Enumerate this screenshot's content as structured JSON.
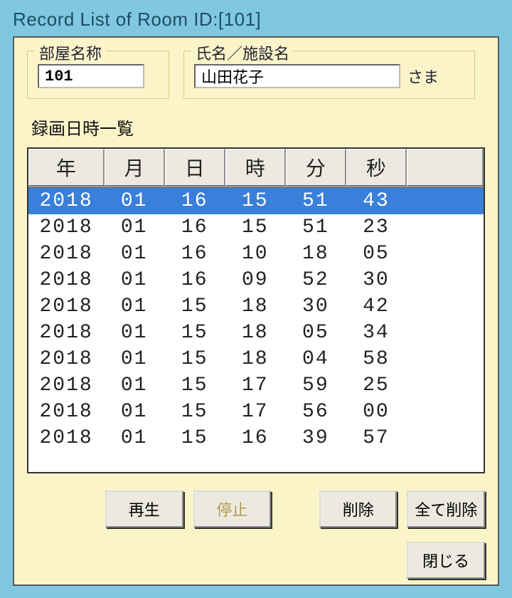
{
  "window": {
    "title": "Record List of Room ID:[101]"
  },
  "fields": {
    "room_label": "部屋名称",
    "room_value": "101",
    "name_label": "氏名／施設名",
    "name_value": "山田花子",
    "honorific": "さま"
  },
  "list_label": "録画日時一覧",
  "columns": {
    "year": "年",
    "month": "月",
    "day": "日",
    "hour": "時",
    "minute": "分",
    "second": "秒"
  },
  "rows": [
    {
      "y": "2018",
      "m": "01",
      "d": "16",
      "h": "15",
      "mi": "51",
      "s": "43",
      "selected": true
    },
    {
      "y": "2018",
      "m": "01",
      "d": "16",
      "h": "15",
      "mi": "51",
      "s": "23"
    },
    {
      "y": "2018",
      "m": "01",
      "d": "16",
      "h": "10",
      "mi": "18",
      "s": "05"
    },
    {
      "y": "2018",
      "m": "01",
      "d": "16",
      "h": "09",
      "mi": "52",
      "s": "30"
    },
    {
      "y": "2018",
      "m": "01",
      "d": "15",
      "h": "18",
      "mi": "30",
      "s": "42"
    },
    {
      "y": "2018",
      "m": "01",
      "d": "15",
      "h": "18",
      "mi": "05",
      "s": "34"
    },
    {
      "y": "2018",
      "m": "01",
      "d": "15",
      "h": "18",
      "mi": "04",
      "s": "58"
    },
    {
      "y": "2018",
      "m": "01",
      "d": "15",
      "h": "17",
      "mi": "59",
      "s": "25"
    },
    {
      "y": "2018",
      "m": "01",
      "d": "15",
      "h": "17",
      "mi": "56",
      "s": "00"
    },
    {
      "y": "2018",
      "m": "01",
      "d": "15",
      "h": "16",
      "mi": "39",
      "s": "57"
    }
  ],
  "buttons": {
    "play": "再生",
    "stop": "停止",
    "delete": "削除",
    "delete_all": "全て削除",
    "close": "閉じる"
  }
}
